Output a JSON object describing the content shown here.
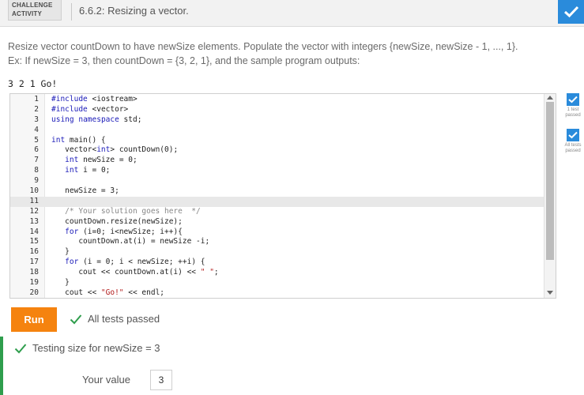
{
  "header": {
    "badge_line1": "CHALLENGE",
    "badge_line2": "ACTIVITY",
    "title": "6.6.2: Resizing a vector."
  },
  "description": "Resize vector countDown to have newSize elements. Populate the vector with integers {newSize, newSize - 1, ..., 1}. Ex: If newSize = 3, then countDown = {3, 2, 1}, and the sample program outputs:",
  "sample_output": "3 2 1 Go!",
  "editor": {
    "active_line": 11,
    "lines": [
      {
        "n": "1",
        "text": "#include <iostream>"
      },
      {
        "n": "2",
        "text": "#include <vector>"
      },
      {
        "n": "3",
        "text": "using namespace std;"
      },
      {
        "n": "4",
        "text": ""
      },
      {
        "n": "5",
        "text": "int main() {"
      },
      {
        "n": "6",
        "text": "   vector<int> countDown(0);"
      },
      {
        "n": "7",
        "text": "   int newSize = 0;"
      },
      {
        "n": "8",
        "text": "   int i = 0;"
      },
      {
        "n": "9",
        "text": ""
      },
      {
        "n": "10",
        "text": "   newSize = 3;"
      },
      {
        "n": "11",
        "text": ""
      },
      {
        "n": "12",
        "text": "   /* Your solution goes here  */"
      },
      {
        "n": "13",
        "text": "   countDown.resize(newSize);"
      },
      {
        "n": "14",
        "text": "   for (i=0; i<newSize; i++){"
      },
      {
        "n": "15",
        "text": "      countDown.at(i) = newSize -i;"
      },
      {
        "n": "16",
        "text": "   }"
      },
      {
        "n": "17",
        "text": "   for (i = 0; i < newSize; ++i) {"
      },
      {
        "n": "18",
        "text": "      cout << countDown.at(i) << \" \";"
      },
      {
        "n": "19",
        "text": "   }"
      },
      {
        "n": "20",
        "text": "   cout << \"Go!\" << endl;"
      }
    ]
  },
  "side_tests": [
    {
      "label": "1 test passed"
    },
    {
      "label": "All tests passed"
    }
  ],
  "run_button": "Run",
  "status_text": "All tests passed",
  "test_case": "Testing size for newSize = 3",
  "your_value_label": "Your value",
  "your_value": "3",
  "colors": {
    "accent_blue": "#2a8bdb",
    "run_orange": "#f5830f",
    "success_green": "#2f9e4d"
  }
}
